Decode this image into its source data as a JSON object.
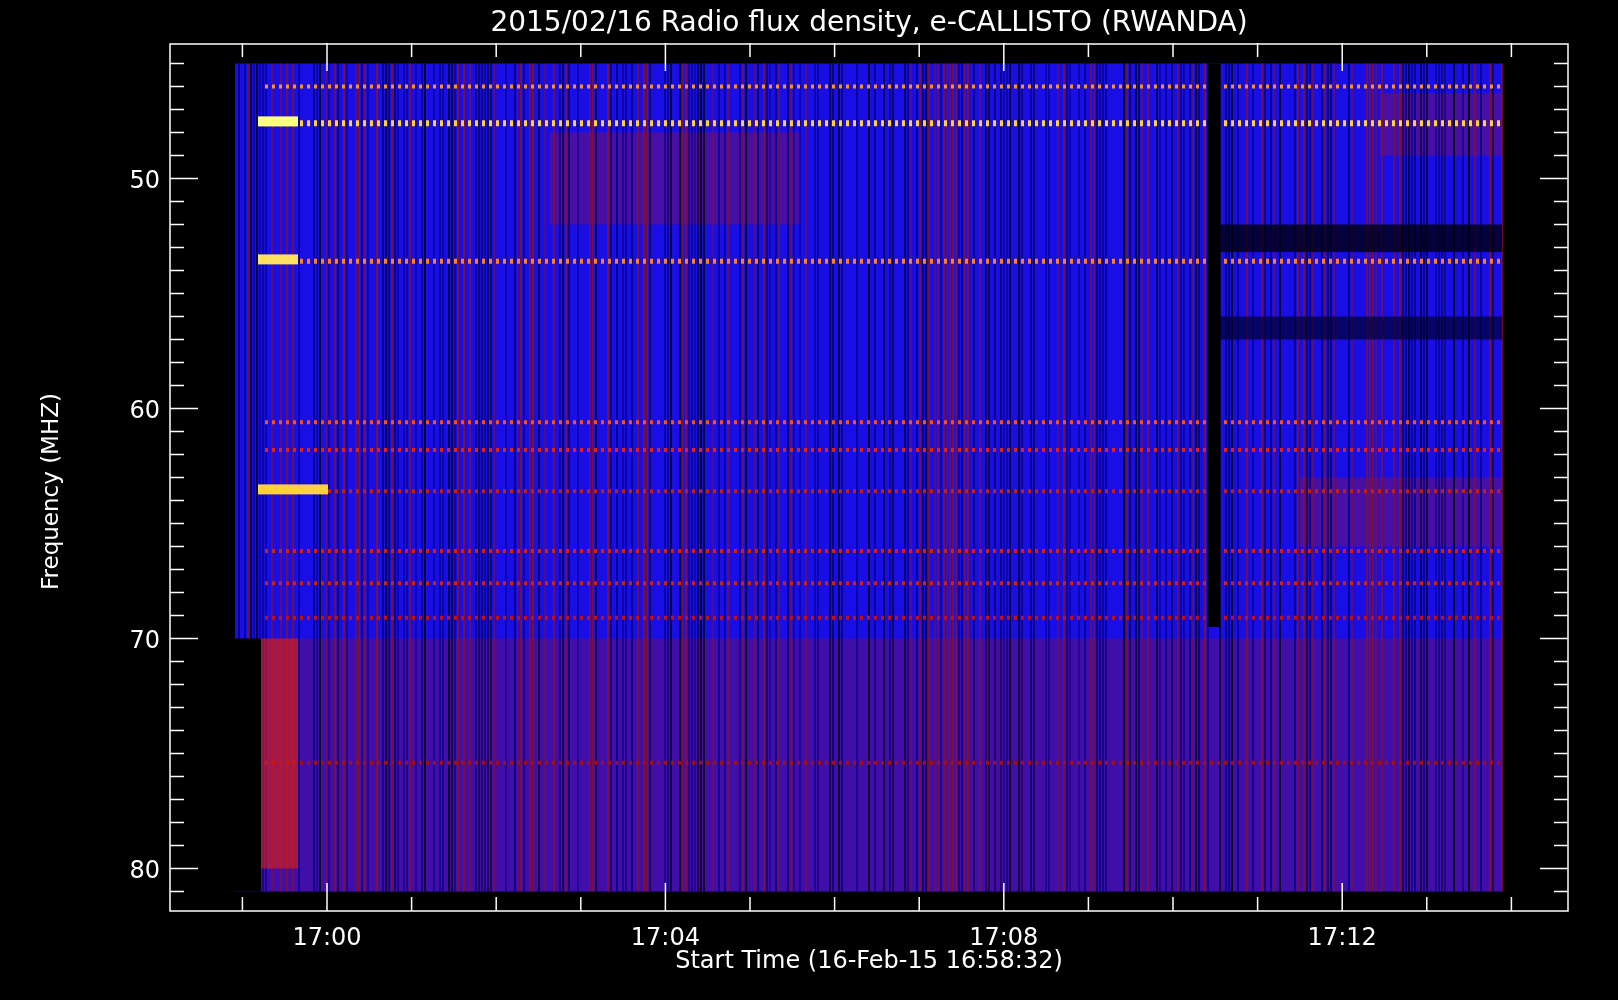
{
  "title": "2015/02/16  Radio flux density, e-CALLISTO (RWANDA)",
  "y_axis": {
    "label": "Frequency (MHZ)",
    "ticks": [
      "50",
      "60",
      "70",
      "80"
    ]
  },
  "x_axis": {
    "label": "Start Time (16-Feb-15 16:58:32)",
    "ticks": [
      "17:00",
      "17:04",
      "17:08",
      "17:12"
    ]
  }
}
